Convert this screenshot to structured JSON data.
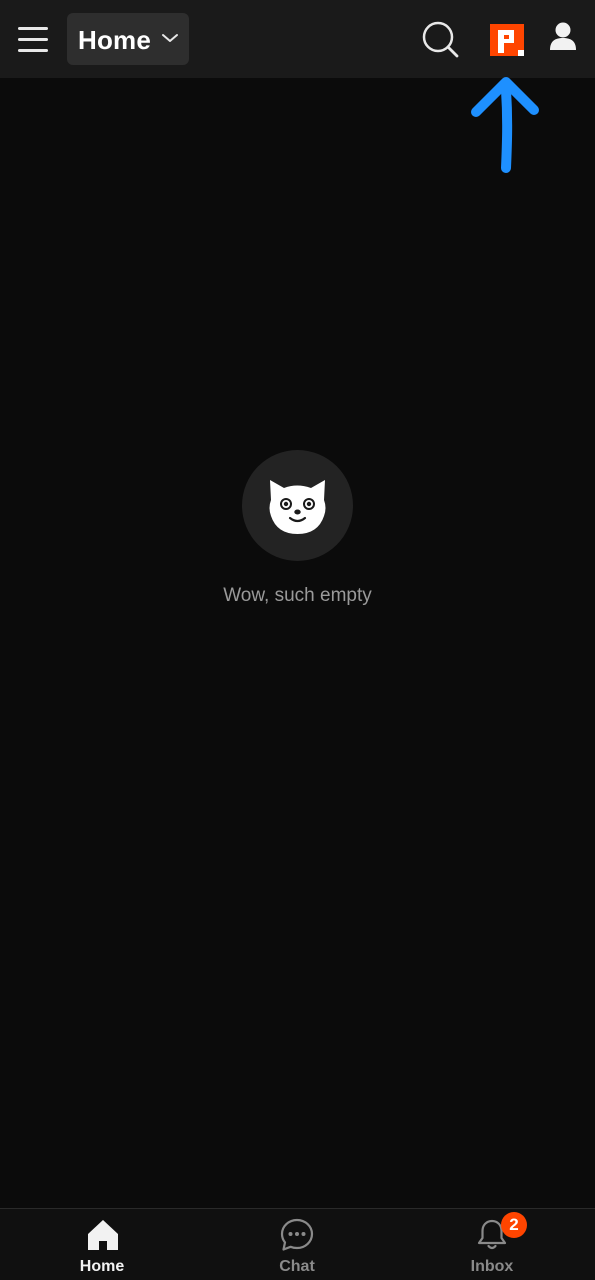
{
  "header": {
    "feed_selector_label": "Home",
    "icons": [
      "menu-icon",
      "chevron-down-icon",
      "search-icon",
      "premium-icon",
      "profile-icon"
    ]
  },
  "empty_state": {
    "message": "Wow, such empty",
    "icon": "snoo-cat-icon"
  },
  "bottom_nav": {
    "items": [
      {
        "label": "Home",
        "icon": "home-icon",
        "active": true
      },
      {
        "label": "Chat",
        "icon": "chat-icon",
        "active": false
      },
      {
        "label": "Inbox",
        "icon": "bell-icon",
        "active": false,
        "badge": "2"
      }
    ]
  },
  "colors": {
    "background": "#0b0b0b",
    "topbar": "#1a1a1a",
    "accent": "#ff4500",
    "annotation_arrow": "#1e90ff"
  }
}
